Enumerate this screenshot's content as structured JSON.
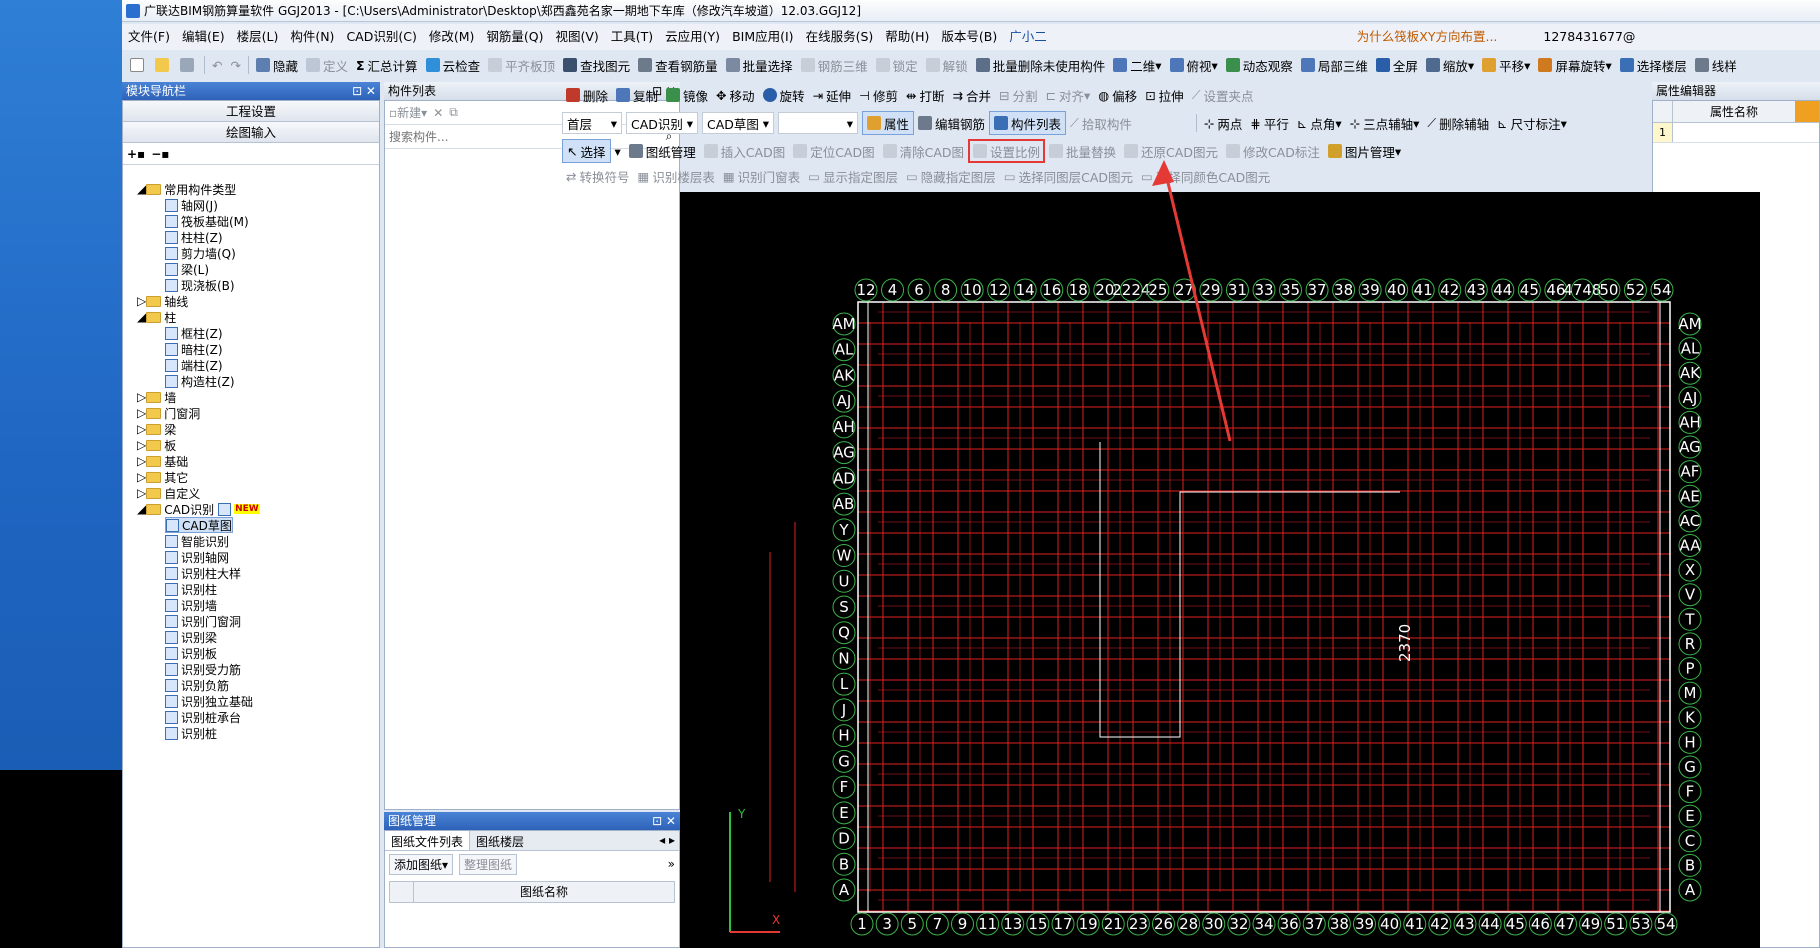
{
  "window": {
    "title": "广联达BIM钢筋算量软件 GGJ2013 - [C:\\Users\\Administrator\\Desktop\\郑西鑫苑名家一期地下车库（修改汽车坡道）12.03.GGJ12]"
  },
  "menu": {
    "items": [
      "文件(F)",
      "编辑(E)",
      "楼层(L)",
      "构件(N)",
      "CAD识别(C)",
      "修改(M)",
      "钢筋量(Q)",
      "视图(V)",
      "工具(T)",
      "云应用(Y)",
      "BIM应用(I)",
      "在线服务(S)",
      "帮助(H)",
      "版本号(B)",
      "广小二"
    ],
    "notice": "为什么筏板XY方向布置...",
    "user": "1278431677@"
  },
  "toolbar1": {
    "items": [
      "隐藏",
      "定义",
      "汇总计算",
      "云检查",
      "平齐板顶",
      "查找图元",
      "查看钢筋量",
      "批量选择",
      "钢筋三维",
      "锁定",
      "解锁",
      "批量删除未使用构件",
      "二维",
      "俯视",
      "动态观察",
      "局部三维",
      "全屏",
      "缩放",
      "平移",
      "屏幕旋转",
      "选择楼层",
      "线样"
    ]
  },
  "toolbar2": {
    "items": [
      "删除",
      "复制",
      "镜像",
      "移动",
      "旋转",
      "延伸",
      "修剪",
      "打断",
      "合并",
      "分割",
      "对齐",
      "偏移",
      "拉伸",
      "设置夹点"
    ]
  },
  "toolbar3": {
    "floor": "首层",
    "type": "CAD识别",
    "sub": "CAD草图",
    "items": [
      "属性",
      "编辑钢筋",
      "构件列表",
      "拾取构件",
      "两点",
      "平行",
      "点角",
      "三点辅轴",
      "删除辅轴",
      "尺寸标注"
    ]
  },
  "toolbar4": {
    "items": [
      "选择",
      "图纸管理",
      "插入CAD图",
      "定位CAD图",
      "清除CAD图",
      "设置比例",
      "批量替换",
      "还原CAD图元",
      "修改CAD标注",
      "图片管理"
    ]
  },
  "toolbar5": {
    "items": [
      "转换符号",
      "识别楼层表",
      "识别门窗表",
      "显示指定图层",
      "隐藏指定图层",
      "选择同图层CAD图元",
      "选择同颜色CAD图元"
    ]
  },
  "nav": {
    "title": "模块导航栏",
    "btn1": "工程设置",
    "btn2": "绘图输入",
    "tree": [
      "常用构件类型",
      "轴网(J)",
      "筏板基础(M)",
      "柱柱(Z)",
      "剪力墙(Q)",
      "梁(L)",
      "现浇板(B)",
      "轴线",
      "柱",
      "框柱(Z)",
      "暗柱(Z)",
      "端柱(Z)",
      "构造柱(Z)",
      "墙",
      "门窗洞",
      "梁",
      "板",
      "基础",
      "其它",
      "自定义",
      "CAD识别",
      "CAD草图",
      "智能识别",
      "识别轴网",
      "识别柱大样",
      "识别柱",
      "识别墙",
      "识别门窗洞",
      "识别梁",
      "识别板",
      "识别受力筋",
      "识别负筋",
      "识别独立基础",
      "识别桩承台",
      "识别桩"
    ],
    "new_badge": "NEW"
  },
  "components": {
    "title": "构件列表",
    "new_label": "新建",
    "search_placeholder": "搜索构件..."
  },
  "drawings": {
    "title": "图纸管理",
    "tab1": "图纸文件列表",
    "tab2": "图纸楼层",
    "add": "添加图纸",
    "organize": "整理图纸",
    "col": "图纸名称"
  },
  "props": {
    "title": "属性编辑器",
    "col": "属性名称",
    "row1": "1"
  },
  "cad": {
    "top_axes": [
      "12",
      "4",
      "6",
      "8",
      "10",
      "12",
      "14",
      "16",
      "18",
      "20",
      "2224",
      "25",
      "27",
      "29",
      "31",
      "33",
      "35",
      "37",
      "38",
      "39",
      "40",
      "41",
      "42",
      "43",
      "44",
      "45",
      "46",
      "4748",
      "50",
      "52",
      "54"
    ],
    "bottom_axes": [
      "1",
      "3",
      "5",
      "7",
      "9",
      "11",
      "13",
      "15",
      "17",
      "19",
      "21",
      "23",
      "26",
      "28",
      "30",
      "32",
      "34",
      "36",
      "37",
      "38",
      "39",
      "40",
      "41",
      "42",
      "43",
      "44",
      "45",
      "46",
      "47",
      "49",
      "51",
      "53",
      "54"
    ],
    "left_axes": [
      "AM",
      "AL",
      "AK",
      "AJ",
      "AH",
      "AG",
      "AD",
      "AB",
      "Y",
      "W",
      "U",
      "S",
      "Q",
      "N",
      "L",
      "J",
      "H",
      "G",
      "F",
      "E",
      "D",
      "B",
      "A"
    ],
    "right_axes": [
      "AM",
      "AL",
      "AK",
      "AJ",
      "AH",
      "AG",
      "AF",
      "AE",
      "AC",
      "AA",
      "X",
      "V",
      "T",
      "R",
      "P",
      "M",
      "K",
      "H",
      "G",
      "F",
      "E",
      "C",
      "B",
      "A"
    ],
    "dimension": "2370",
    "ucs_y": "Y",
    "ucs_x": "X"
  },
  "colors": {
    "grid": "#e0201e",
    "highlight": "#e53935",
    "titlebg": "#2d62b8"
  }
}
